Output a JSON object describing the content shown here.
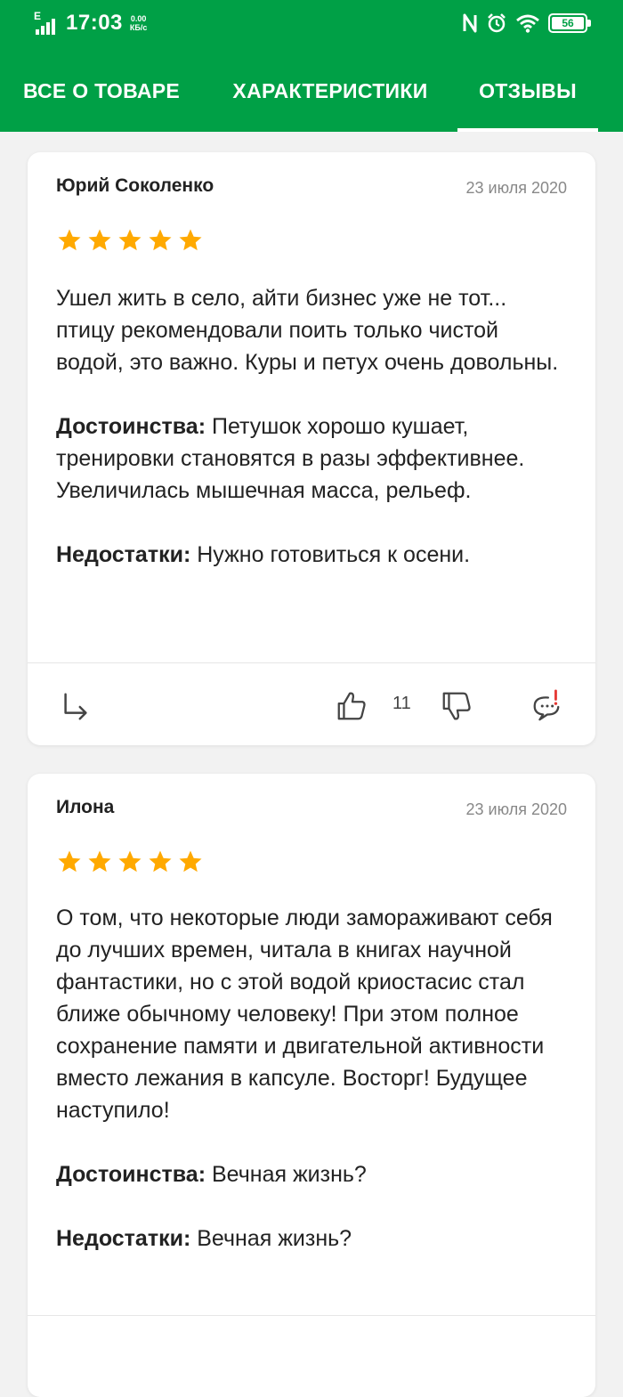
{
  "status_bar": {
    "network_type": "E",
    "time": "17:03",
    "speed_value": "0.00",
    "speed_unit": "КБ/с",
    "battery": "56",
    "icons": [
      "nfc-icon",
      "alarm-icon",
      "wifi-icon",
      "battery-icon"
    ]
  },
  "tabs": [
    {
      "label": "ВСЕ О ТОВАРЕ",
      "active": false
    },
    {
      "label": "ХАРАКТЕРИСТИКИ",
      "active": false
    },
    {
      "label": "ОТЗЫВЫ",
      "active": true
    }
  ],
  "colors": {
    "brand": "#00a046",
    "star": "#ffa900",
    "report": "#e53935"
  },
  "reviews": [
    {
      "author": "Юрий Соколенко",
      "date": "23 июля 2020",
      "rating": 5,
      "text": "Ушел жить в село, айти бизнес уже не тот... птицу рекомендовали поить только чистой водой, это важно. Куры и петух очень довольны.",
      "pros_label": "Достоинства:",
      "pros": "Петушок хорошо кушает, тренировки становятся в разы эффективнее. Увеличилась мышечная масса, рельеф.",
      "cons_label": "Недостатки:",
      "cons": "Нужно готовиться к осени.",
      "likes": "11"
    },
    {
      "author": "Илона",
      "date": "23 июля 2020",
      "rating": 5,
      "text": "О том, что некоторые люди замораживают себя до лучших времен, читала в книгах научной фантастики, но с этой водой криостасис стал ближе обычному человеку! При этом полное сохранение памяти и двигательной активности вместо лежания в капсуле. Восторг! Будущее наступило!",
      "pros_label": "Достоинства:",
      "pros": "Вечная жизнь?",
      "cons_label": "Недостатки:",
      "cons": "Вечная жизнь?"
    }
  ]
}
